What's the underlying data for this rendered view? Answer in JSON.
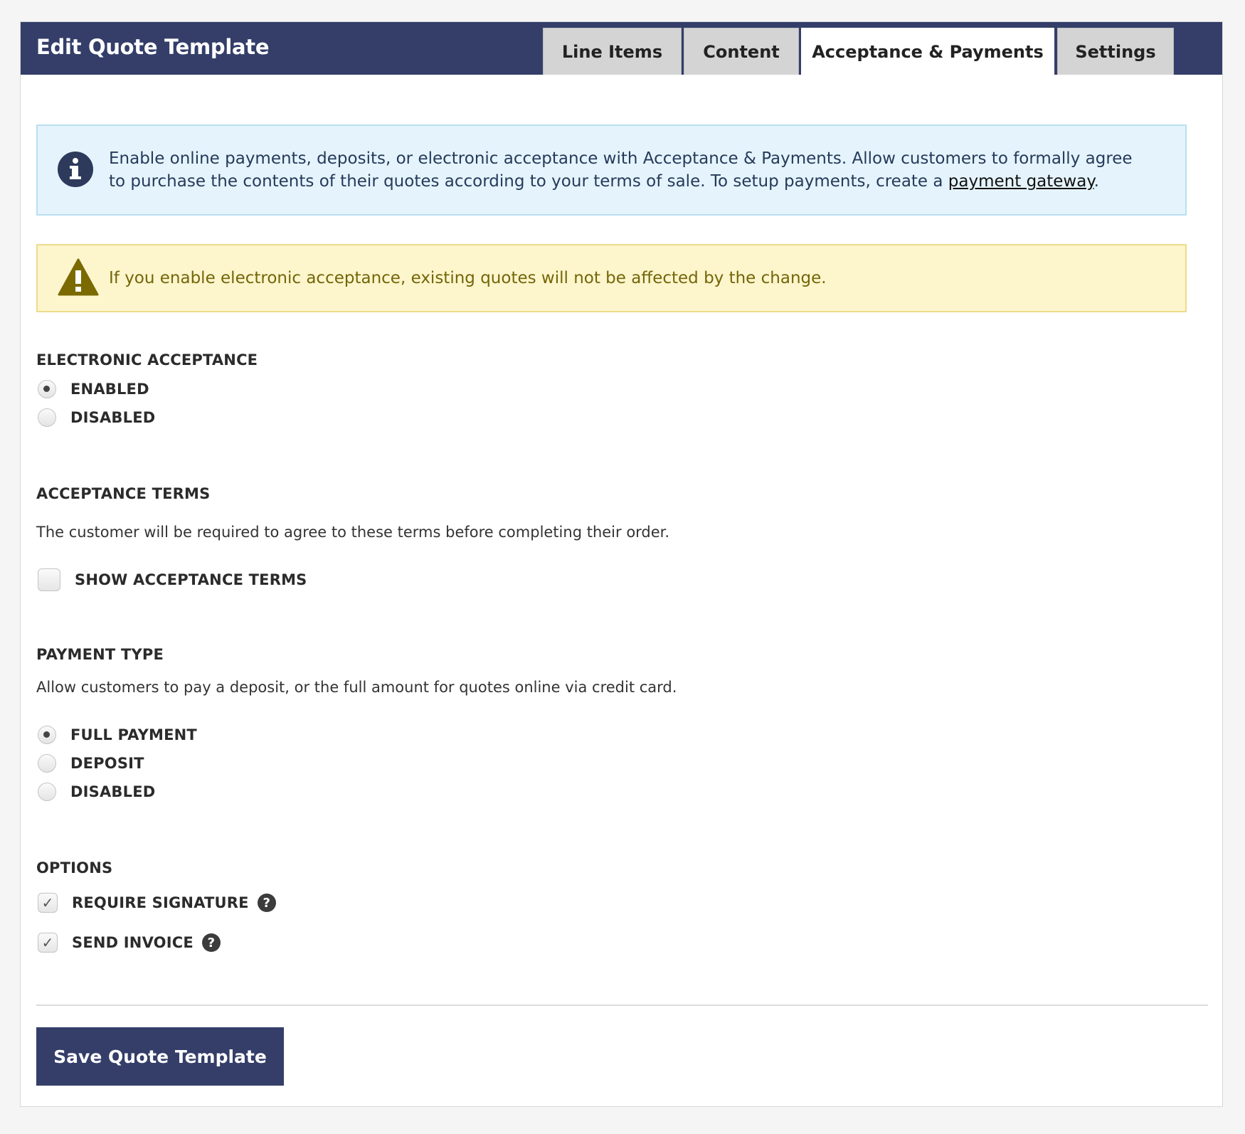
{
  "header": {
    "title": "Edit Quote Template",
    "tabs": [
      {
        "label": "Line Items",
        "active": false
      },
      {
        "label": "Content",
        "active": false
      },
      {
        "label": "Acceptance & Payments",
        "active": true
      },
      {
        "label": "Settings",
        "active": false
      }
    ]
  },
  "info_alert": {
    "text": "Enable online payments, deposits, or electronic acceptance with Acceptance & Payments. Allow customers to formally agree to purchase the contents of their quotes according to your terms of sale. To setup payments, create a ",
    "link_text": "payment gateway",
    "text_after": "."
  },
  "warning_alert": {
    "text": "If you enable electronic acceptance, existing quotes will not be affected by the change."
  },
  "electronic_acceptance": {
    "heading": "ELECTRONIC ACCEPTANCE",
    "options": [
      {
        "label": "ENABLED",
        "selected": true
      },
      {
        "label": "DISABLED",
        "selected": false
      }
    ]
  },
  "acceptance_terms": {
    "heading": "ACCEPTANCE TERMS",
    "description": "The customer will be required to agree to these terms before completing their order.",
    "checkbox_label": "SHOW ACCEPTANCE TERMS",
    "checked": false
  },
  "payment_type": {
    "heading": "PAYMENT TYPE",
    "description": "Allow customers to pay a deposit, or the full amount for quotes online via credit card.",
    "options": [
      {
        "label": "FULL PAYMENT",
        "selected": true
      },
      {
        "label": "DEPOSIT",
        "selected": false
      },
      {
        "label": "DISABLED",
        "selected": false
      }
    ]
  },
  "options": {
    "heading": "OPTIONS",
    "items": [
      {
        "label": "REQUIRE SIGNATURE",
        "checked": true
      },
      {
        "label": "SEND INVOICE",
        "checked": true
      }
    ]
  },
  "footer": {
    "save_label": "Save Quote Template"
  },
  "colors": {
    "header_bg": "#343e69",
    "info_bg": "#e5f4fc",
    "warning_bg": "#fdf5cc",
    "warning_icon": "#7a6a00",
    "info_icon": "#2e3a5c"
  }
}
